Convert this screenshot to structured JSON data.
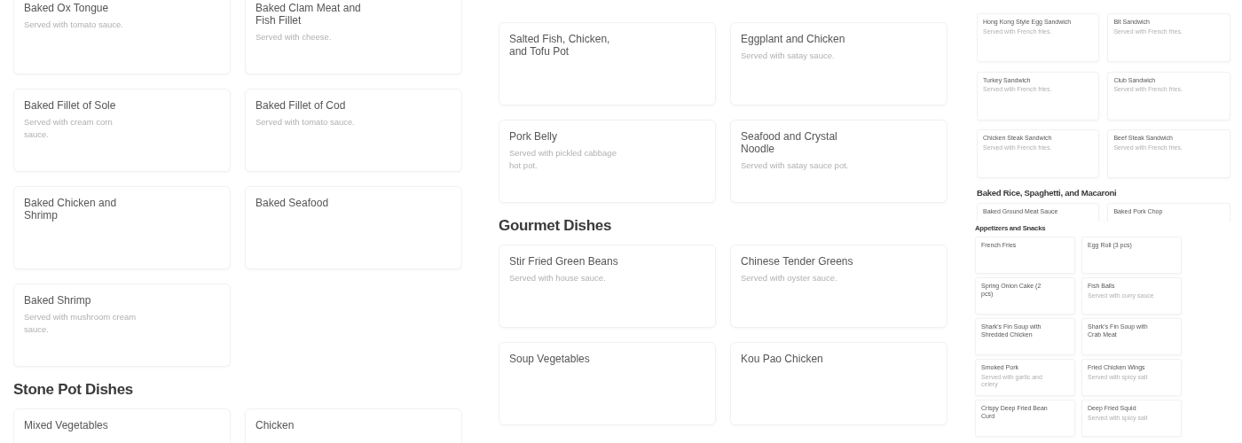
{
  "panels": [
    {
      "sections": [
        {
          "items": [
            {
              "name": "Baked Ox Tongue",
              "description": "Served with tomato sauce."
            },
            {
              "name": "Baked Clam Meat and Fish Fillet",
              "description": "Served with cheese."
            },
            {
              "name": "Baked Fillet of Sole",
              "description": "Served with cream corn sauce."
            },
            {
              "name": "Baked Fillet of Cod",
              "description": "Served with tomato sauce."
            },
            {
              "name": "Baked Chicken and Shrimp"
            },
            {
              "name": "Baked Seafood"
            },
            {
              "name": "Baked Shrimp",
              "description": "Served with mushroom cream sauce."
            }
          ]
        },
        {
          "heading": "Stone Pot Dishes",
          "items": [
            {
              "name": "Mixed Vegetables"
            },
            {
              "name": "Chicken"
            }
          ]
        }
      ]
    },
    {
      "sections": [
        {
          "items": [
            {
              "name": "Salted Fish, Chicken, and Tofu Pot"
            },
            {
              "name": "Eggplant and Chicken",
              "description": "Served with satay sauce."
            },
            {
              "name": "Pork Belly",
              "description": "Served with pickled cabbage hot pot."
            },
            {
              "name": "Seafood and Crystal Noodle",
              "description": "Served with satay sauce pot."
            }
          ]
        },
        {
          "heading": "Gourmet Dishes",
          "items": [
            {
              "name": "Stir Fried Green Beans",
              "description": "Served with house sauce."
            },
            {
              "name": "Chinese Tender Greens",
              "description": "Served with oyster sauce."
            },
            {
              "name": "Soup Vegetables"
            },
            {
              "name": "Kou Pao Chicken"
            }
          ]
        }
      ]
    },
    {
      "sections": [
        {
          "items": [
            {
              "name": "Hong Kong Style Egg Sandwich",
              "description": "Served with French fries."
            },
            {
              "name": "Blt Sandwich",
              "description": "Served with French fries."
            },
            {
              "name": "Turkey Sandwich",
              "description": "Served with French fries."
            },
            {
              "name": "Club Sandwich",
              "description": "Served with French fries."
            },
            {
              "name": "Chicken Steak Sandwich",
              "description": "Served with French fries."
            },
            {
              "name": "Beef Steak Sandwich",
              "description": "Served with French fries."
            }
          ]
        },
        {
          "heading": "Baked Rice, Spaghetti, and Macaroni",
          "items": [
            {
              "name": "Baked Ground Meat Sauce"
            },
            {
              "name": "Baked Pork Chop"
            }
          ]
        }
      ]
    },
    {
      "sections": [
        {
          "heading": "Appetizers and Snacks",
          "items": [
            {
              "name": "French Fries"
            },
            {
              "name": "Egg Roll (3 pcs)"
            },
            {
              "name": "Spring Onion Cake (2 pcs)"
            },
            {
              "name": "Fish Balls",
              "description": "Served with curry sauce"
            },
            {
              "name": "Shark's Fin Soup with Shredded Chicken"
            },
            {
              "name": "Shark's Fin Soup with Crab Meat"
            },
            {
              "name": "Smoked Pork",
              "description": "Served with garlic and celery"
            },
            {
              "name": "Fried Chicken Wings",
              "description": "Served with spicy salt"
            },
            {
              "name": "Crispy Deep Fried Bean Curd"
            },
            {
              "name": "Deep Fried Squid",
              "description": "Served with spicy salt"
            }
          ]
        }
      ]
    }
  ]
}
